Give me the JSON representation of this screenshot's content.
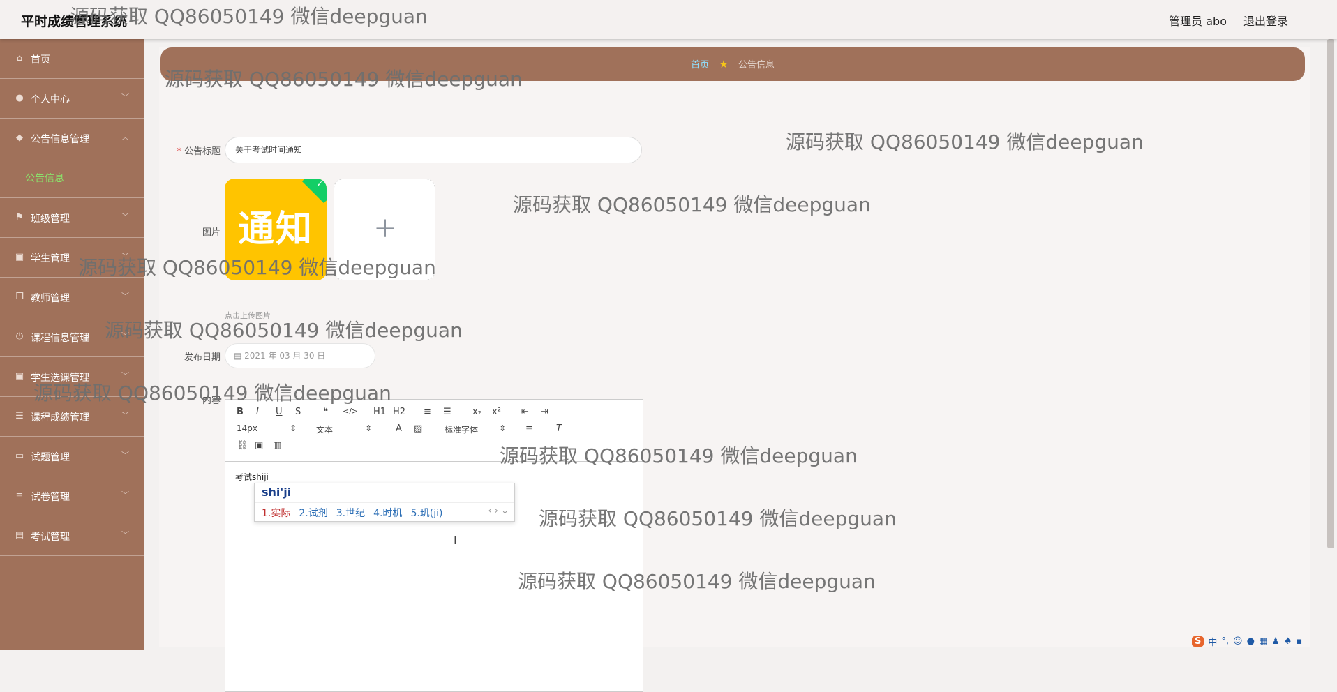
{
  "app": {
    "title": "平时成绩管理系统",
    "user_label": "管理员 abo",
    "logout_label": "退出登录"
  },
  "sidebar": {
    "items": [
      {
        "label": "首页",
        "icon": "home-icon"
      },
      {
        "label": "个人中心",
        "icon": "user-icon"
      },
      {
        "label": "公告信息管理",
        "icon": "bell-icon"
      },
      {
        "label": "公告信息",
        "sub": true
      },
      {
        "label": "班级管理",
        "icon": "flag-icon"
      },
      {
        "label": "学生管理",
        "icon": "clipboard-icon"
      },
      {
        "label": "教师管理",
        "icon": "copy-icon"
      },
      {
        "label": "课程信息管理",
        "icon": "power-icon"
      },
      {
        "label": "学生选课管理",
        "icon": "clipboard-icon"
      },
      {
        "label": "课程成绩管理",
        "icon": "list-icon"
      },
      {
        "label": "试题管理",
        "icon": "monitor-icon"
      },
      {
        "label": "试卷管理",
        "icon": "sliders-icon"
      },
      {
        "label": "考试管理",
        "icon": "briefcase-icon"
      }
    ]
  },
  "breadcrumb": {
    "home": "首页",
    "current": "公告信息"
  },
  "form": {
    "title_label": "公告标题",
    "title_value": "关于考试时间通知",
    "image_label": "图片",
    "image_text": "通知",
    "upload_tip": "点击上传图片",
    "date_label": "发布日期",
    "date_value": "2021 年 03 月 30 日",
    "content_label": "内容",
    "content_text": "考试shiji"
  },
  "editor": {
    "toolbar_row1": [
      "B",
      "I",
      "U",
      "S",
      "❝",
      "</>",
      "H1",
      "H2",
      "≡",
      "☰",
      "x₂",
      "x²",
      "⇤",
      "⇥"
    ],
    "size_value": "14px",
    "heading_value": "文本",
    "font_value": "标准字体"
  },
  "ime": {
    "input": "shi'ji",
    "candidates": [
      "1.实际",
      "2.试剂",
      "3.世纪",
      "4.时机",
      "5.玑(ji)"
    ]
  },
  "tray": {
    "lang": "中",
    "punct": "°,"
  },
  "watermark": "源码获取 QQ86050149 微信deepguan"
}
